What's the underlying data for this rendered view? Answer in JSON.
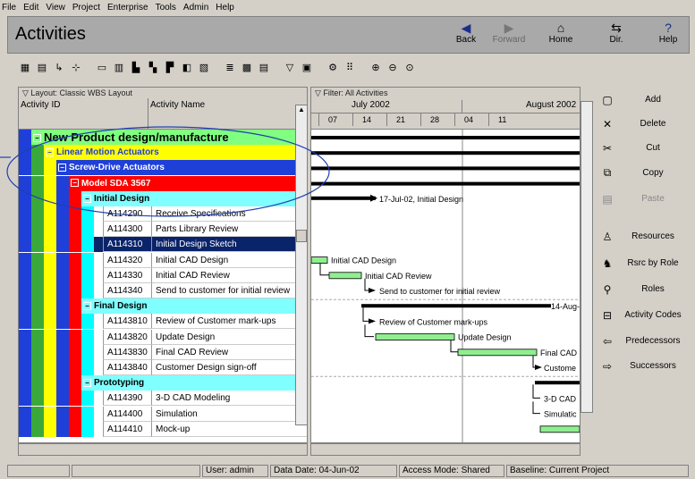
{
  "menu": [
    "File",
    "Edit",
    "View",
    "Project",
    "Enterprise",
    "Tools",
    "Admin",
    "Help"
  ],
  "header": {
    "title": "Activities",
    "back": "Back",
    "forward": "Forward",
    "home": "Home",
    "dir": "Dir.",
    "help": "Help"
  },
  "table": {
    "layout_label": "Layout: Classic WBS Layout",
    "col_id": "Activity ID",
    "col_name": "Activity Name",
    "groups": [
      {
        "label": "New Product design/manufacture"
      },
      {
        "label": "Linear Motion Actuators"
      },
      {
        "label": "Screw-Drive Actuators"
      },
      {
        "label": "Model SDA 3567"
      },
      {
        "label": "Initial Design"
      },
      {
        "label": "Final Design"
      },
      {
        "label": "Prototyping"
      }
    ],
    "rows": [
      {
        "id": "A114290",
        "name": "Receive Specifications"
      },
      {
        "id": "A114300",
        "name": "Parts Library Review"
      },
      {
        "id": "A114310",
        "name": "Initial Design Sketch"
      },
      {
        "id": "A114320",
        "name": "Initial CAD Design"
      },
      {
        "id": "A114330",
        "name": "Initial CAD Review"
      },
      {
        "id": "A114340",
        "name": "Send to customer for initial review"
      },
      {
        "id": "A1143810",
        "name": "Review of Customer mark-ups"
      },
      {
        "id": "A1143820",
        "name": "Update Design"
      },
      {
        "id": "A1143830",
        "name": "Final CAD Review"
      },
      {
        "id": "A1143840",
        "name": "Customer Design sign-off"
      },
      {
        "id": "A114390",
        "name": "3-D CAD Modeling"
      },
      {
        "id": "A114400",
        "name": "Simulation"
      },
      {
        "id": "A114410",
        "name": "Mock-up"
      }
    ]
  },
  "gantt": {
    "filter_label": "Filter: All Activities",
    "months": [
      "July 2002",
      "August 2002"
    ],
    "days": [
      "07",
      "14",
      "21",
      "28",
      "04",
      "11"
    ],
    "labels": {
      "initial_design": "17-Jul-02, Initial Design",
      "initial_cad_design": "Initial CAD Design",
      "initial_cad_review": "Initial CAD Review",
      "send_customer": "Send to customer for initial review",
      "aug14": "14-Aug-(",
      "review_markups": "Review of Customer mark-ups",
      "update_design": "Update Design",
      "final_cad": "Final CAD",
      "customer": "Custome",
      "cad3d": "3-D CAD",
      "simulation": "Simulatic"
    }
  },
  "right_panel": {
    "add": "Add",
    "delete": "Delete",
    "cut": "Cut",
    "copy": "Copy",
    "paste": "Paste",
    "resources": "Resources",
    "rsrc_by_role": "Rsrc by Role",
    "roles": "Roles",
    "activity_codes": "Activity Codes",
    "predecessors": "Predecessors",
    "successors": "Successors"
  },
  "status": {
    "user": "User: admin",
    "data_date": "Data Date: 04-Jun-02",
    "access": "Access Mode: Shared",
    "baseline": "Baseline: Current Project"
  }
}
